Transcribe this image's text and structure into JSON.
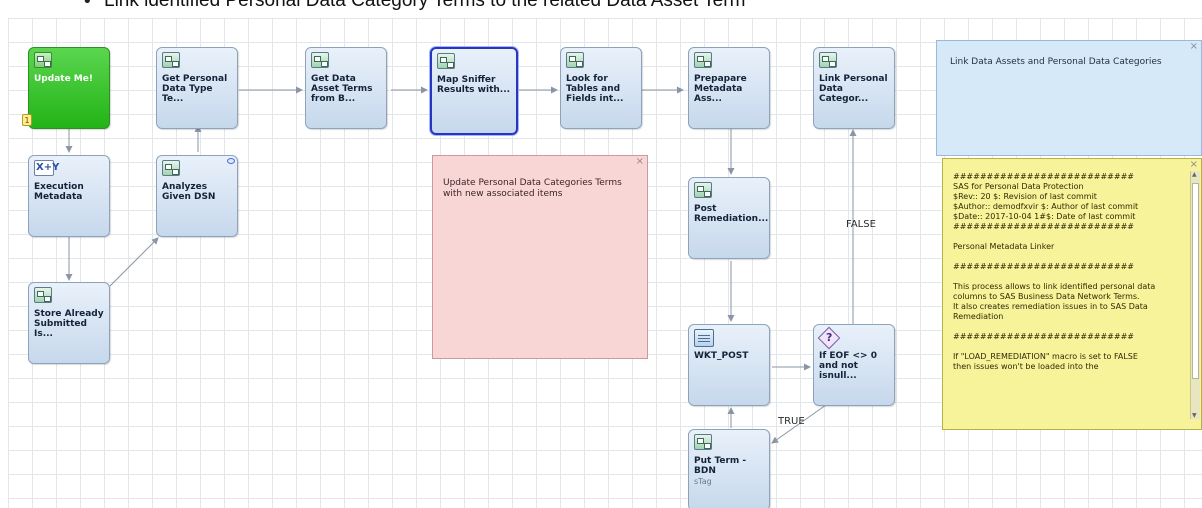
{
  "heading": {
    "bullet": "•",
    "text": "Link identified Personal Data Category Terms to the related Data Asset Term"
  },
  "nodes": {
    "update_me": {
      "label": "Update Me!",
      "badge": "1"
    },
    "execution_metadata": {
      "icon_text": "X+Y",
      "label": "Execution Metadata"
    },
    "store_already": {
      "label": "Store Already Submitted Is..."
    },
    "analyzes_dsn": {
      "label": "Analyzes Given DSN"
    },
    "get_personal": {
      "label": "Get Personal Data Type Te..."
    },
    "get_data_asset": {
      "label": "Get Data Asset Terms from B..."
    },
    "map_sniffer": {
      "label": "Map Sniffer Results with..."
    },
    "look_for_tables": {
      "label": "Look for Tables and Fields int..."
    },
    "prepare_metadata": {
      "label": "Prepapare Metadata Ass..."
    },
    "post_remediation": {
      "label": "Post Remediation..."
    },
    "wkt_post": {
      "label": "WKT_POST"
    },
    "put_term": {
      "label": "Put Term - BDN",
      "sublabel": "sTag"
    },
    "if_eof": {
      "icon_text": "?",
      "label": "If EOF <> 0 and not isnull..."
    },
    "link_personal": {
      "label": "Link Personal Data Categor..."
    }
  },
  "edge_labels": {
    "false_label": "FALSE",
    "true_label": "TRUE"
  },
  "notes": {
    "blue": {
      "text": "Link Data Assets and Personal Data Categories",
      "close": "×"
    },
    "pink": {
      "text": "Update Personal Data Categories Terms with new associated items",
      "close": "×"
    },
    "yellow": {
      "close": "×",
      "lines": [
        "###########################",
        "SAS for Personal Data Protection",
        "$Rev:: 20            $:  Revision of last commit",
        "$Author:: demodfxvir $:  Author of last commit",
        "$Date:: 2017-10-04 1#$:  Date of last commit",
        "###########################",
        "",
        "Personal Metadata Linker",
        "",
        "###########################",
        "",
        "This process allows to link identified personal data",
        "columns to SAS Business Data Network Terms.",
        "It also creates remediation issues in to SAS Data",
        "Remediation",
        "",
        "###########################",
        "",
        "If \"LOAD_REMEDIATION\" macro is set to FALSE",
        "then issues won't be loaded into the"
      ]
    }
  },
  "colors": {
    "node_fill": "#c6d8ec",
    "start_node": "#22b316",
    "selected_border": "#2336c4",
    "note_blue": "#d6e9f8",
    "note_pink": "#f9d6d6",
    "note_yellow": "#f7f39a",
    "connector": "#8a96a6"
  }
}
